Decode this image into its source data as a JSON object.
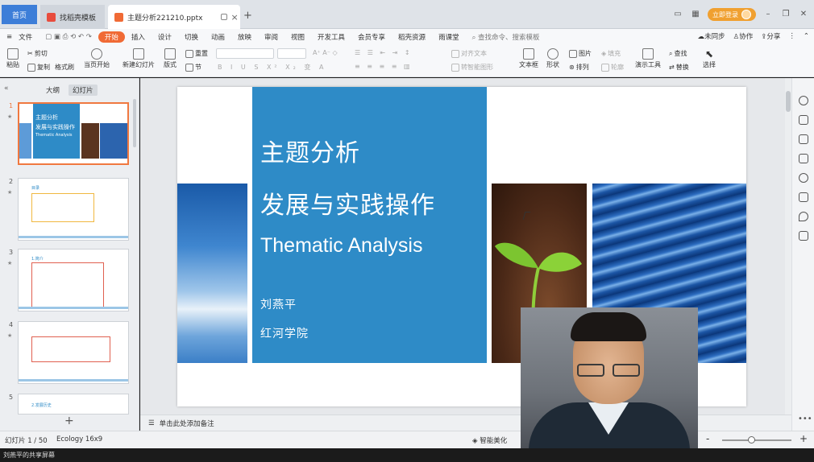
{
  "tabs": [
    {
      "label": "首页",
      "active": false
    },
    {
      "label": "找稻壳模板",
      "active": false
    },
    {
      "label": "主题分析221210.pptx",
      "active": true
    }
  ],
  "window": {
    "login_label": "立即登录"
  },
  "menu": {
    "file": "文件",
    "items": [
      "开始",
      "插入",
      "设计",
      "切换",
      "动画",
      "放映",
      "审阅",
      "视图",
      "开发工具",
      "会员专享",
      "稻壳资源",
      "雨课堂"
    ],
    "search_placeholder": "查找命令、搜索模板",
    "sync": "未同步",
    "collab": "协作",
    "share": "分享"
  },
  "toolbar": {
    "paste": "粘贴",
    "cut": "剪切",
    "copy": "复制",
    "format_painter": "格式刷",
    "from_current": "当页开始",
    "new_slide": "新建幻灯片",
    "layout": "版式",
    "section": "节",
    "reset": "重置",
    "align_text": "对齐文本",
    "smart_graphic": "转智能图形",
    "textbox": "文本框",
    "shape": "形状",
    "picture": "图片",
    "fill": "填充",
    "arrange": "排列",
    "outline": "轮廓",
    "presenter_tools": "演示工具",
    "find": "查找",
    "replace": "替换",
    "select": "选择"
  },
  "left_panel": {
    "tab_outline": "大纲",
    "tab_slides": "幻灯片",
    "thumbs": [
      {
        "num": "1",
        "title": "主题分析",
        "subtitle": "发展与实践操作",
        "en": "Thematic Analysis",
        "active": true
      },
      {
        "num": "2",
        "title": "目录",
        "active": false
      },
      {
        "num": "3",
        "title": "1.简介",
        "active": false
      },
      {
        "num": "4",
        "title": "",
        "active": false
      },
      {
        "num": "5",
        "title": "2.发展历史",
        "active": false
      }
    ]
  },
  "slide": {
    "title1": "主题分析",
    "title2": "发展与实践操作",
    "title_en": "Thematic Analysis",
    "author": "刘燕平",
    "institution": "红河学院"
  },
  "notes_placeholder": "单击此处添加备注",
  "status": {
    "slide_info": "幻灯片 1 / 50",
    "theme": "Ecology 16x9",
    "beautify": "智能美化"
  },
  "share_label": "刘燕平的共享屏幕",
  "colors": {
    "accent": "#f06a35",
    "slide_blue": "#2e8bc7",
    "home_tab": "#3d7ed8",
    "login": "#f0a030"
  }
}
